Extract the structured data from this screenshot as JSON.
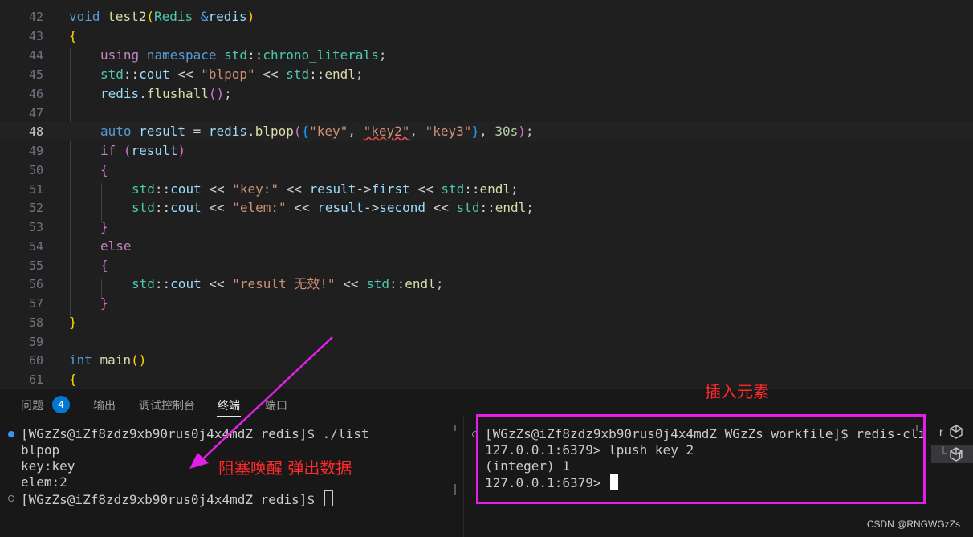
{
  "editor": {
    "lines": [
      {
        "n": "42"
      },
      {
        "n": "43"
      },
      {
        "n": "44"
      },
      {
        "n": "45"
      },
      {
        "n": "46"
      },
      {
        "n": "47"
      },
      {
        "n": "48"
      },
      {
        "n": "49"
      },
      {
        "n": "50"
      },
      {
        "n": "51"
      },
      {
        "n": "52"
      },
      {
        "n": "53"
      },
      {
        "n": "54"
      },
      {
        "n": "55"
      },
      {
        "n": "56"
      },
      {
        "n": "57"
      },
      {
        "n": "58"
      },
      {
        "n": "59"
      },
      {
        "n": "60"
      },
      {
        "n": "61"
      }
    ],
    "current_line": "48",
    "code": {
      "l42": {
        "kw": "void",
        "fn": "test2",
        "p": "(",
        "ty": "Redis",
        "sp": " ",
        "amp": "&",
        "var": "redis",
        "p2": ")"
      },
      "l43": {
        "b": "{"
      },
      "l44": {
        "kw": "using",
        "kw2": "namespace",
        "ns": "std",
        "sep": "::",
        "id": "chrono_literals",
        "semi": ";"
      },
      "l45": {
        "ns": "std",
        "sep": "::",
        "id": "cout",
        "op": " << ",
        "str": "\"blpop\"",
        "op2": " << ",
        "ns2": "std",
        "sep2": "::",
        "id2": "endl",
        "semi": ";"
      },
      "l46": {
        "var": "redis",
        "dot": ".",
        "fn": "flushall",
        "p": "()",
        "semi": ";"
      },
      "l48": {
        "kw": "auto",
        "var": "result",
        "eq": " = ",
        "var2": "redis",
        "dot": ".",
        "fn": "blpop",
        "p": "(",
        "b": "{",
        "s1": "\"key\"",
        "c1": ", ",
        "s2": "\"key2\"",
        "c2": ", ",
        "s3": "\"key3\"",
        "b2": "}",
        "c3": ", ",
        "num": "30s",
        "p2": ")",
        "semi": ";"
      },
      "l49": {
        "kw": "if",
        "p": " (",
        "var": "result",
        "p2": ")"
      },
      "l50": {
        "b": "{"
      },
      "l51": {
        "ns": "std",
        "sep": "::",
        "id": "cout",
        "op": " << ",
        "str": "\"key:\"",
        "op2": " << ",
        "var": "result",
        "arrow": "->",
        "mem": "first",
        "op3": " << ",
        "ns2": "std",
        "sep2": "::",
        "id2": "endl",
        "semi": ";"
      },
      "l52": {
        "ns": "std",
        "sep": "::",
        "id": "cout",
        "op": " << ",
        "str": "\"elem:\"",
        "op2": " << ",
        "var": "result",
        "arrow": "->",
        "mem": "second",
        "op3": " << ",
        "ns2": "std",
        "sep2": "::",
        "id2": "endl",
        "semi": ";"
      },
      "l53": {
        "b": "}"
      },
      "l54": {
        "kw": "else"
      },
      "l55": {
        "b": "{"
      },
      "l56": {
        "ns": "std",
        "sep": "::",
        "id": "cout",
        "op": " << ",
        "str": "\"result 无效!\"",
        "op2": " << ",
        "ns2": "std",
        "sep2": "::",
        "id2": "endl",
        "semi": ";"
      },
      "l57": {
        "b": "}"
      },
      "l58": {
        "b": "}"
      },
      "l60": {
        "kw": "int",
        "fn": "main",
        "p": "()"
      },
      "l61": {
        "b": "{"
      }
    }
  },
  "panel": {
    "tabs": [
      {
        "label": "问题"
      },
      {
        "label": "输出"
      },
      {
        "label": "调试控制台"
      },
      {
        "label": "终端"
      },
      {
        "label": "端口"
      }
    ],
    "problems_count": "4",
    "active_tab": "终端"
  },
  "terminal_left": {
    "lines": [
      "[WGzZs@iZf8zdz9xb90rus0j4x4mdZ redis]$ ./list",
      "blpop",
      "key:key",
      "elem:2",
      "[WGzZs@iZf8zdz9xb90rus0j4x4mdZ redis]$ "
    ]
  },
  "terminal_right": {
    "lines": [
      "[WGzZs@iZf8zdz9xb90rus0j4x4mdZ WGzZs_workfile]$ redis-cli",
      "127.0.0.1:6379> lpush key 2",
      "(integer) 1",
      "127.0.0.1:6379> "
    ]
  },
  "terminal_list": [
    {
      "label": "r"
    },
    {
      "label": "r"
    }
  ],
  "annotations": {
    "blocking": "阻塞唤醒 弹出数据",
    "insert": "插入元素"
  },
  "watermark": "CSDN @RNGWGzZs",
  "colors": {
    "annotation_text": "#ff2a2a",
    "highlight_box": "#e21fe7",
    "arrow": "#e21fe7",
    "badge": "#0078d4"
  }
}
